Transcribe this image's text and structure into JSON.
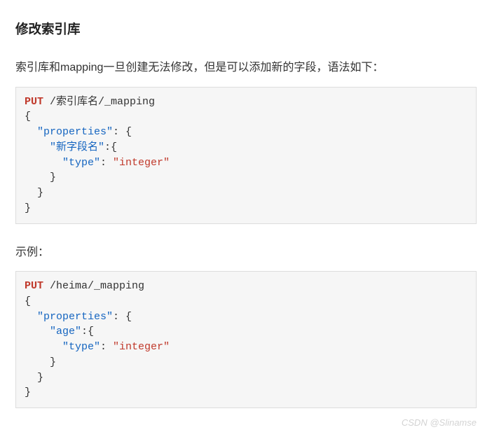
{
  "heading": "修改索引库",
  "intro": "索引库和mapping一旦创建无法修改，但是可以添加新的字段，语法如下：",
  "example_label": "示例：",
  "watermark": "CSDN @Slinamse",
  "code1": {
    "method": "PUT",
    "path": " /索引库名/_mapping",
    "brace_open": "{",
    "properties_key": "\"properties\"",
    "colon_brace": ": {",
    "field_key": "\"新字段名\"",
    "field_colon_brace": ":{",
    "type_key": "\"type\"",
    "type_colon": ": ",
    "type_value": "\"integer\"",
    "close1": "    }",
    "close2": "  }",
    "close3": "}"
  },
  "code2": {
    "method": "PUT",
    "path": " /heima/_mapping",
    "brace_open": "{",
    "properties_key": "\"properties\"",
    "colon_brace": ": {",
    "field_key": "\"age\"",
    "field_colon_brace": ":{",
    "type_key": "\"type\"",
    "type_colon": ": ",
    "type_value": "\"integer\"",
    "close1": "    }",
    "close2": "  }",
    "close3": "}"
  }
}
